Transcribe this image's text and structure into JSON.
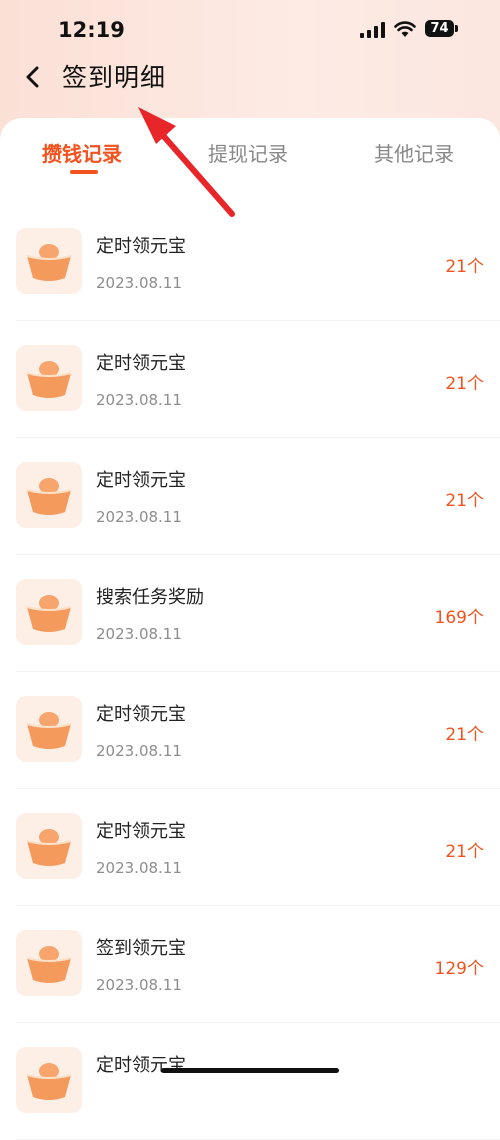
{
  "status_bar": {
    "time": "12:19",
    "battery": "74"
  },
  "nav": {
    "title": "签到明细"
  },
  "tabs": [
    {
      "label": "攒钱记录",
      "active": true
    },
    {
      "label": "提现记录",
      "active": false
    },
    {
      "label": "其他记录",
      "active": false
    }
  ],
  "records": [
    {
      "title": "定时领元宝",
      "date": "2023.08.11",
      "amount": "21个"
    },
    {
      "title": "定时领元宝",
      "date": "2023.08.11",
      "amount": "21个"
    },
    {
      "title": "定时领元宝",
      "date": "2023.08.11",
      "amount": "21个"
    },
    {
      "title": "搜索任务奖励",
      "date": "2023.08.11",
      "amount": "169个"
    },
    {
      "title": "定时领元宝",
      "date": "2023.08.11",
      "amount": "21个"
    },
    {
      "title": "定时领元宝",
      "date": "2023.08.11",
      "amount": "21个"
    },
    {
      "title": "签到领元宝",
      "date": "2023.08.11",
      "amount": "129个"
    },
    {
      "title": "定时领元宝",
      "date": "",
      "amount": ""
    }
  ],
  "colors": {
    "accent": "#f2531e",
    "header_bg": "#fbe0d6",
    "annotation": "#e8262a"
  },
  "icons": {
    "back": "chevron-left-icon",
    "record": "gold-ingot-icon"
  }
}
